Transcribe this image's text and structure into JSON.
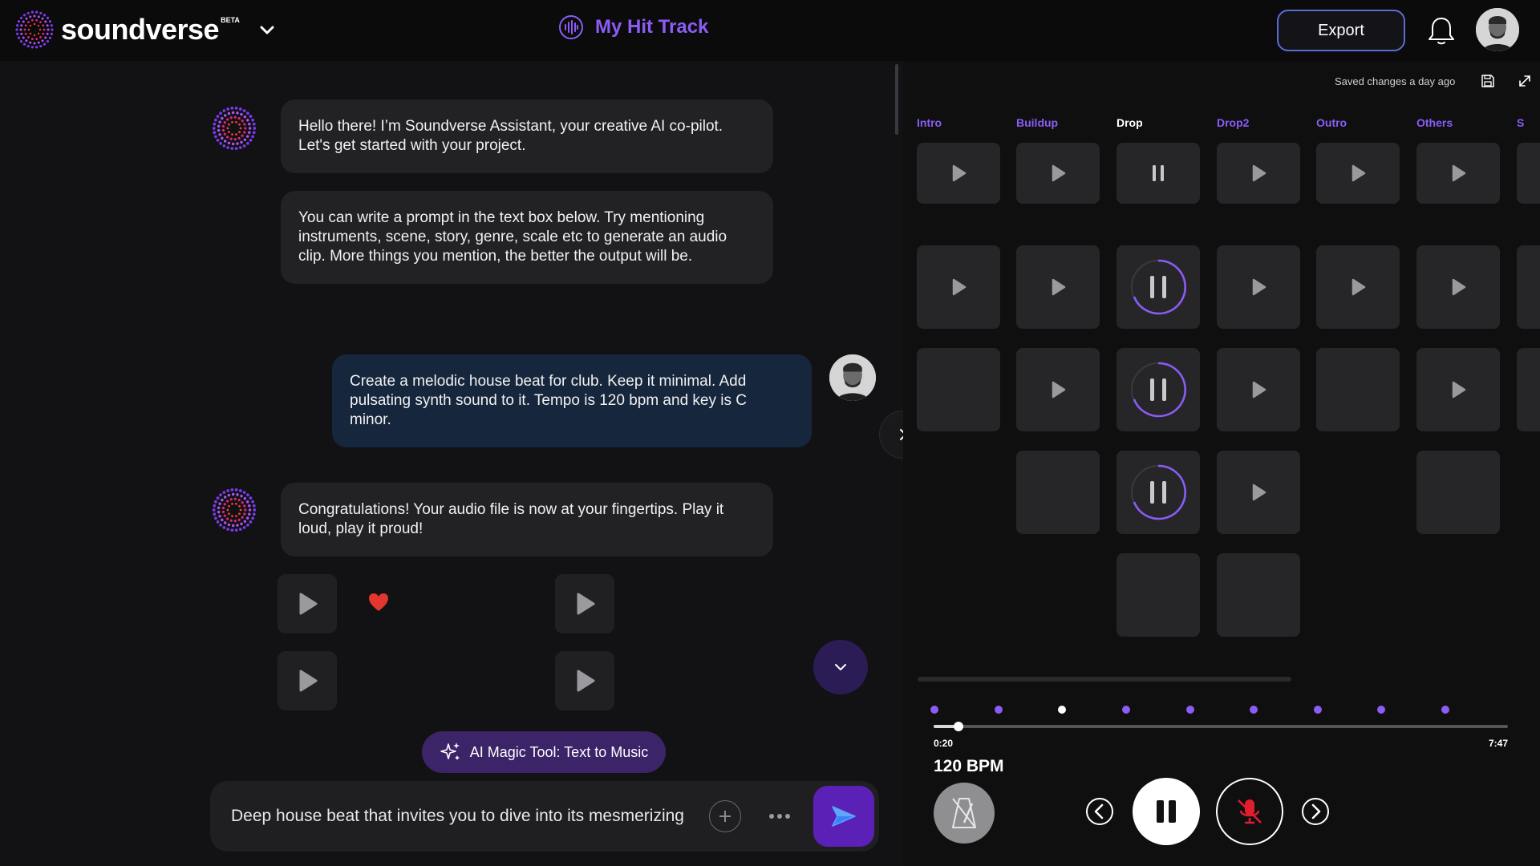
{
  "brand": {
    "name": "soundverse",
    "badge": "BETA"
  },
  "header": {
    "track_title": "My Hit Track",
    "export_label": "Export"
  },
  "chat": {
    "messages": [
      {
        "role": "assistant",
        "text": "Hello there! I’m Soundverse Assistant, your creative AI co-pilot. Let's get started with your project."
      },
      {
        "role": "assistant",
        "text": "You can write a prompt in the text box below. Try mentioning instruments, scene, story, genre, scale etc to generate an audio clip. More things you mention, the better the output will be."
      },
      {
        "role": "user",
        "text": "Create a melodic house beat for club. Keep it minimal. Add pulsating synth sound to it. Tempo is 120 bpm and key is C minor."
      },
      {
        "role": "assistant",
        "text": "Congratulations! Your audio file is now at your fingertips. Play it loud, play it proud!"
      }
    ],
    "magic_tool_label": "AI Magic Tool: Text to Music",
    "input_value": "Deep house beat that invites you to dive into its mesmerizing",
    "accent_color": "#5b21b6"
  },
  "editor": {
    "saved_status": "Saved changes a day ago",
    "sections": [
      "Intro",
      "Buildup",
      "Drop",
      "Drop2",
      "Outro",
      "Others",
      "S"
    ],
    "active_section": "Drop",
    "current_time": "0:20",
    "total_time": "7:47",
    "playback_progress_fraction": 0.043,
    "bpm_label": "120 BPM"
  }
}
